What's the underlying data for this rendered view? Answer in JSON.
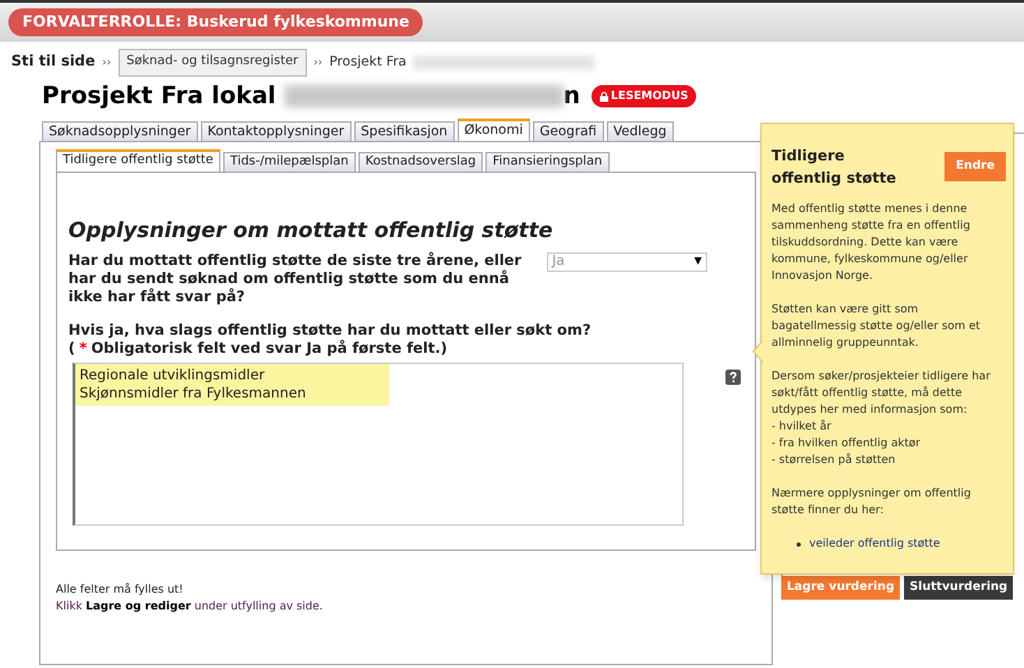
{
  "role_badge": "FORVALTERROLLE: Buskerud fylkeskommune",
  "breadcrumb": {
    "label": "Sti til side",
    "separator": "››",
    "items": [
      {
        "kind": "button",
        "text": "Søknad- og tilsagnsregister"
      },
      {
        "kind": "text",
        "text": "Prosjekt Fra",
        "redacted": true
      }
    ]
  },
  "title": {
    "text": "Prosjekt Fra lokal",
    "redacted_tail": "n",
    "badge": "LESEMODUS"
  },
  "tabs": [
    {
      "label": "Søknadsopplysninger",
      "selected": false
    },
    {
      "label": "Kontaktopplysninger",
      "selected": false
    },
    {
      "label": "Spesifikasjon",
      "selected": false
    },
    {
      "label": "Økonomi",
      "selected": true
    },
    {
      "label": "Geografi",
      "selected": false
    },
    {
      "label": "Vedlegg",
      "selected": false
    }
  ],
  "subtabs": [
    {
      "label": "Tidligere offentlig støtte",
      "selected": true
    },
    {
      "label": "Tids-/milepælsplan",
      "selected": false
    },
    {
      "label": "Kostnadsoverslag",
      "selected": false
    },
    {
      "label": "Finansieringsplan",
      "selected": false
    }
  ],
  "section_heading": "Opplysninger om mottatt offentlig støtte",
  "question_1": {
    "label": "Har du mottatt offentlig støtte de siste tre årene, eller har du sendt søknad om offentlig støtte som du ennå ikke har fått svar på?",
    "value": "Ja",
    "arrow": "▼",
    "disabled": true
  },
  "question_2": {
    "label": "Hvis ja, hva slags offentlig støtte har du mottatt eller søkt om?",
    "note_open": "(",
    "required_mark": "*",
    "note": "Obligatorisk felt ved svar Ja på første felt.)",
    "lines": [
      "Regionale utviklingsmidler",
      "Skjønnsmidler fra Fylkesmannen"
    ],
    "highlighted": true
  },
  "footer": {
    "line_1": "Alle felter må fylles ut!",
    "line_2": "Klikk **Lagre og rediger** under utfylling av side."
  },
  "help_popup": {
    "title": "Tidligere offentlig støtte",
    "button": "Endre",
    "paragraphs": [
      "Med offentlig støtte menes i denne sammenheng støtte fra en offentlig tilskuddsordning. Dette kan være kommune, fylkeskommune og/eller Innovasjon Norge.",
      "Støtten kan være gitt som bagatellmessig støtte og/eller som et allminnelig gruppeunntak.",
      "Dersom søker/prosjekteier tidligere har søkt/fått offentlig støtte, må dette utdypes her med informasjon som:\n- hvilket år\n- fra hvilken offentlig aktør\n- størrelsen på støtten",
      "Nærmere opplysninger om offentlig støtte finner du her:"
    ],
    "links": [
      "veileder offentlig støtte"
    ]
  },
  "actions": [
    {
      "label": "Lagre vurdering",
      "kind": "primary"
    },
    {
      "label": "Sluttvurdering",
      "kind": "dark"
    }
  ]
}
